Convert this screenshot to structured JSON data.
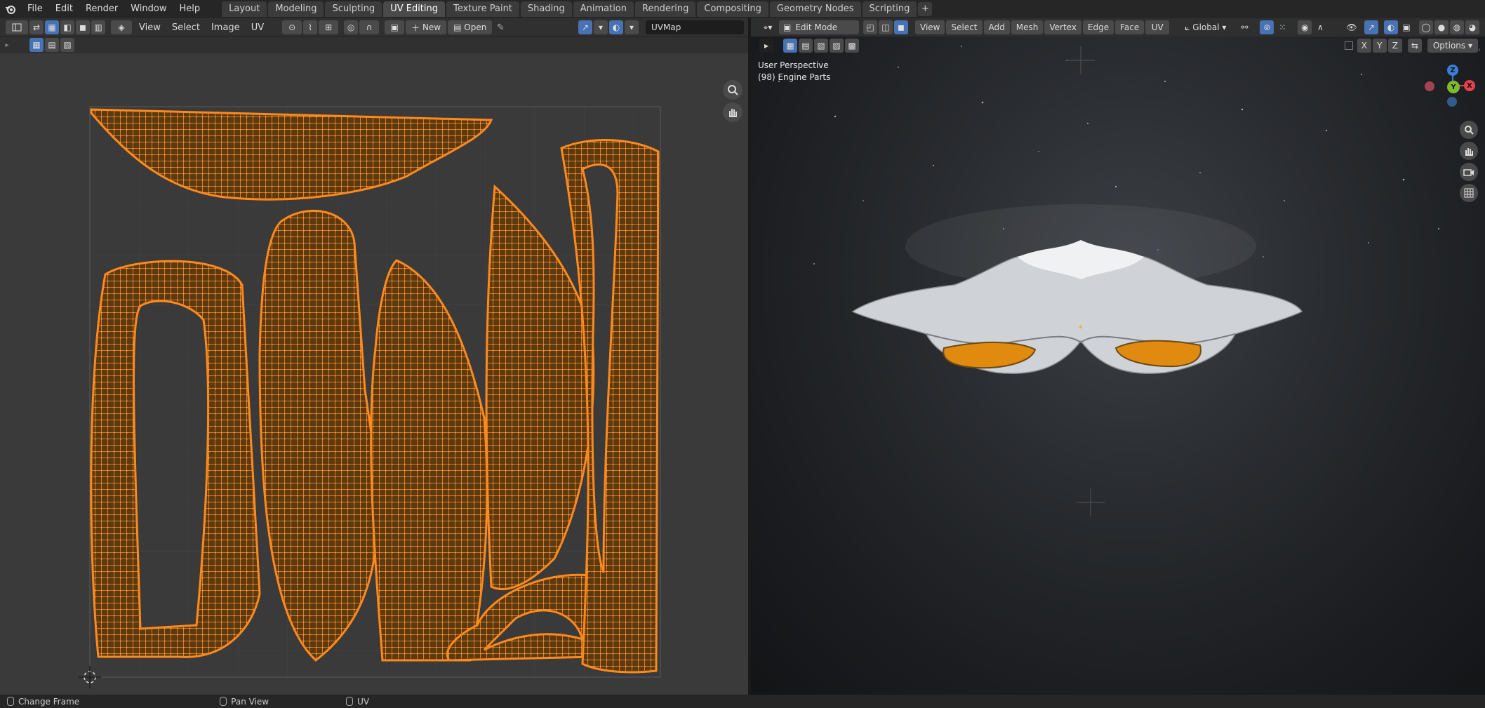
{
  "topbar": {
    "menus": [
      "File",
      "Edit",
      "Render",
      "Window",
      "Help"
    ],
    "workspaces": [
      "Layout",
      "Modeling",
      "Sculpting",
      "UV Editing",
      "Texture Paint",
      "Shading",
      "Animation",
      "Rendering",
      "Compositing",
      "Geometry Nodes",
      "Scripting"
    ],
    "active_workspace": "UV Editing"
  },
  "uv_editor": {
    "menus": [
      "View",
      "Select",
      "Image",
      "UV"
    ],
    "new_label": "New",
    "open_label": "Open",
    "uvmap_name": "UVMap"
  },
  "viewport": {
    "mode": "Edit Mode",
    "menus": [
      "View",
      "Select",
      "Add",
      "Mesh",
      "Vertex",
      "Edge",
      "Face",
      "UV"
    ],
    "transform_orientation": "Global",
    "options_label": "Options",
    "axis_toggles": [
      "X",
      "Y",
      "Z"
    ],
    "view_name": "User Perspective",
    "object_info": "(98) Engine Parts",
    "gizmo_labels": {
      "z": "Z",
      "y": "Y",
      "x": "X"
    }
  },
  "statusbar": {
    "items": [
      "Change Frame",
      "Pan View",
      "UV"
    ]
  },
  "colors": {
    "uv_orange": "#ff8a1c",
    "selected_blue": "#4772b3",
    "axis_x": "#e8404f",
    "axis_y": "#7dba2e",
    "axis_z": "#3c7fdb"
  },
  "icons": [
    "blender-logo-icon",
    "mode-icon",
    "select-mode-icons",
    "zoom-icon",
    "hand-pan-icon",
    "camera-icon",
    "grid-icon",
    "pin-icon",
    "snap-icon",
    "proportional-edit-icon"
  ]
}
